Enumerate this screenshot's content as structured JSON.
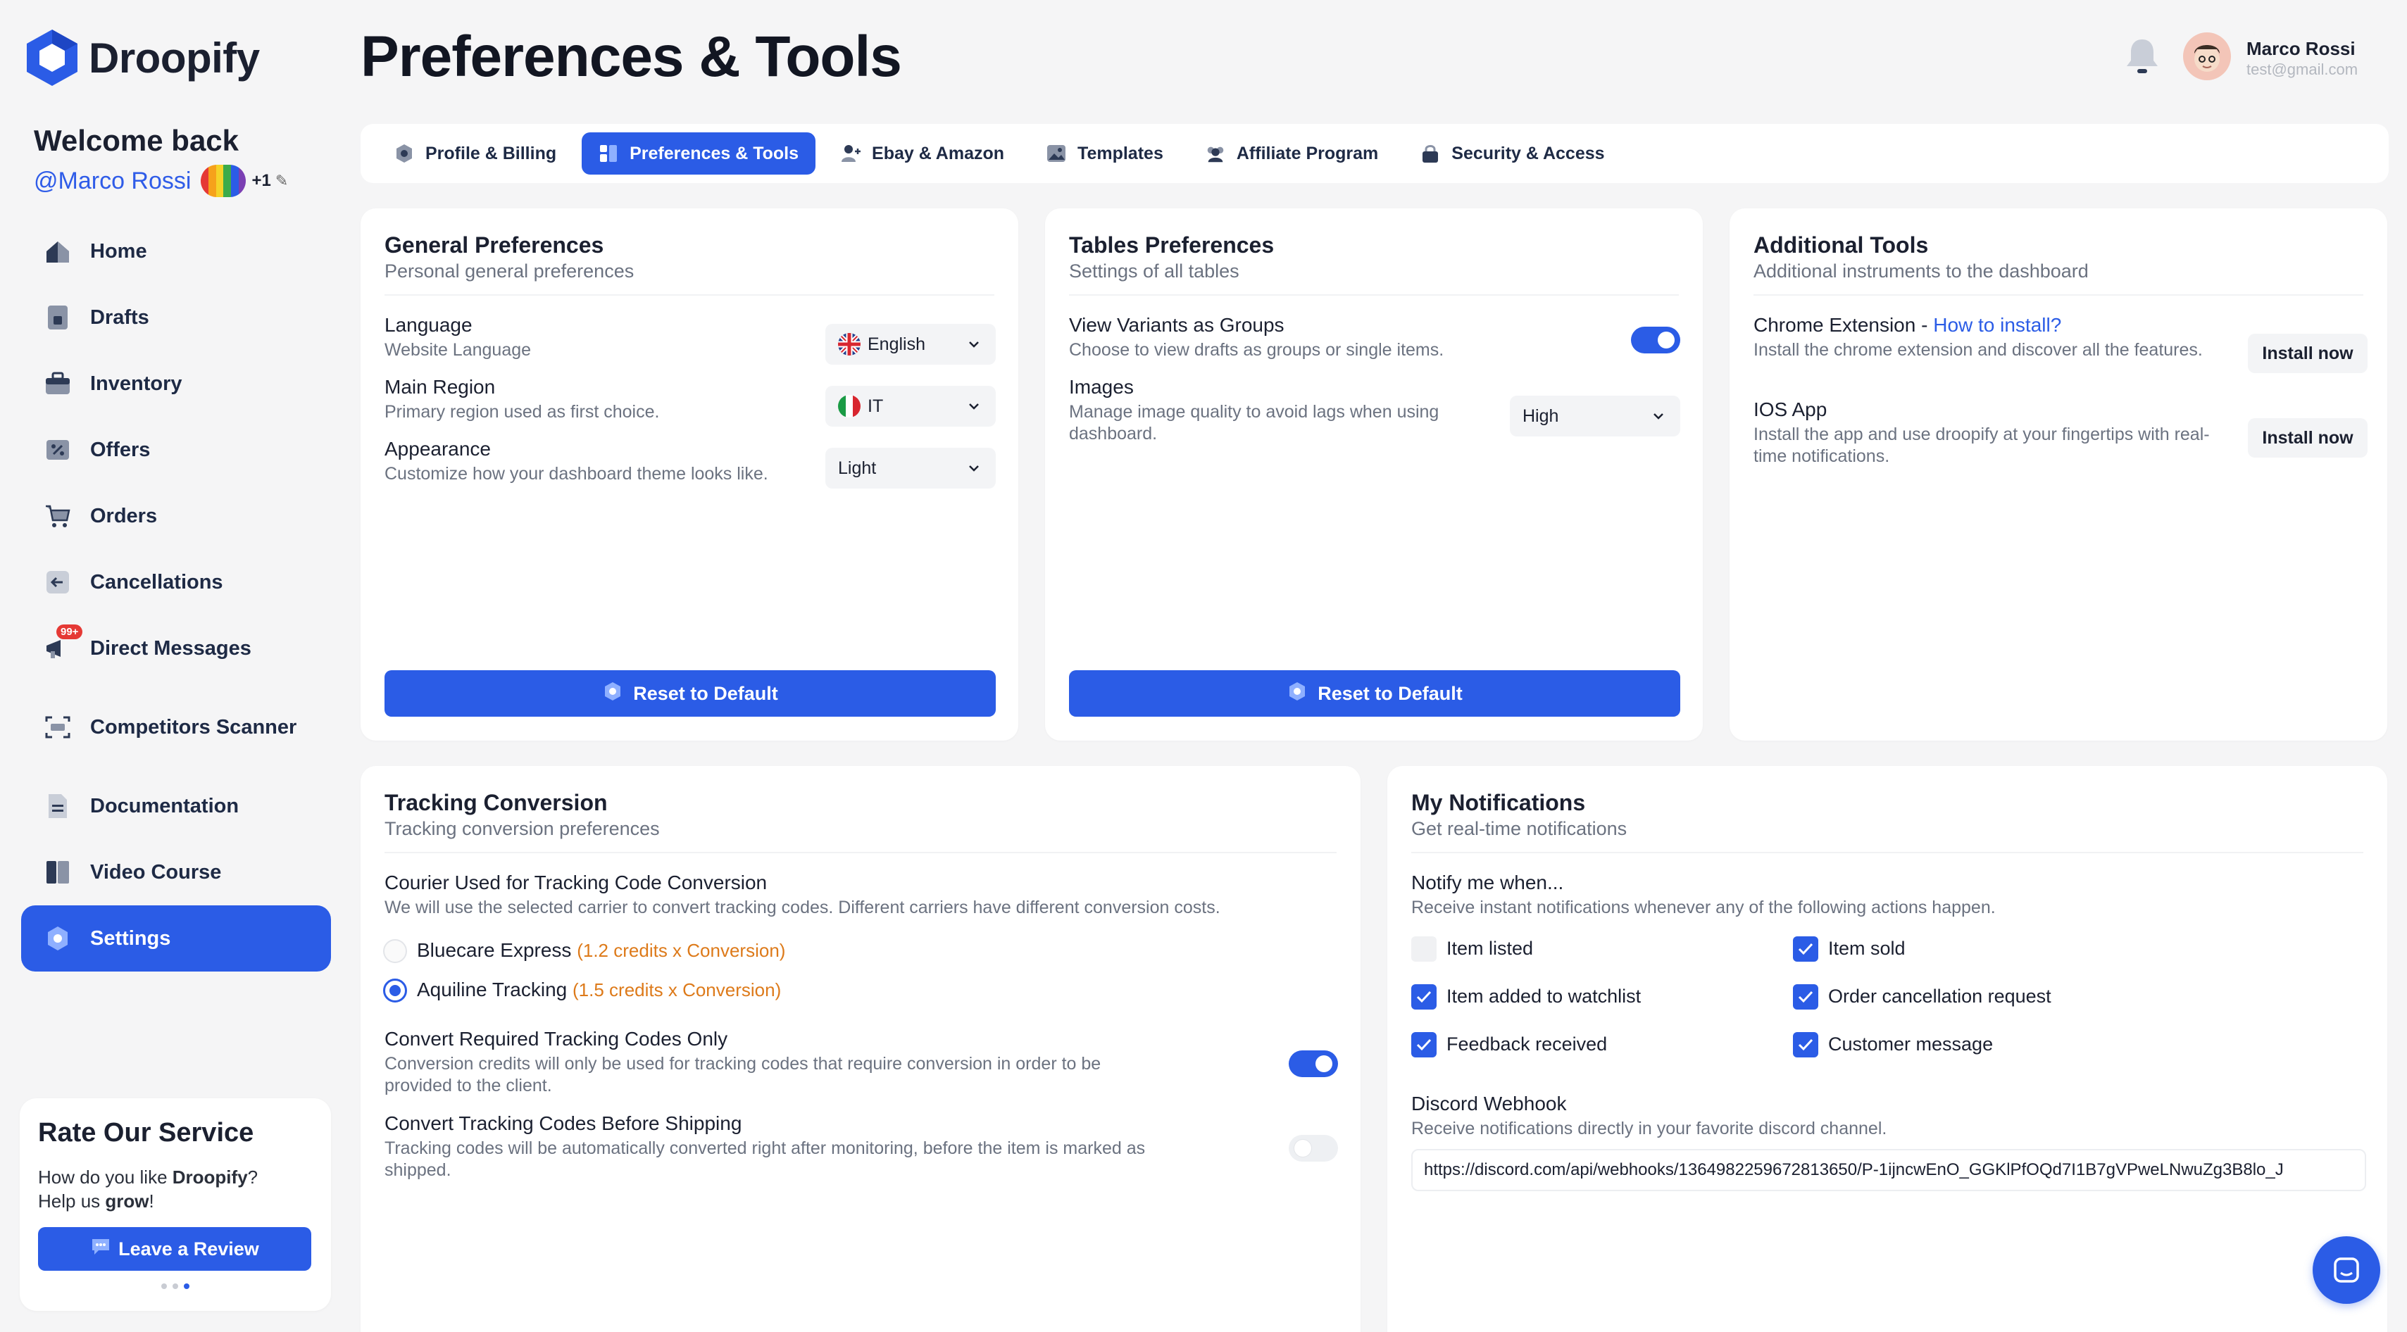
{
  "app": {
    "brand": "Droopify",
    "accent": "#2b5ce6"
  },
  "header": {
    "title": "Preferences & Tools",
    "user_name": "Marco Rossi",
    "user_email": "test@gmail.com"
  },
  "sidebar": {
    "welcome": "Welcome back",
    "handle": "@Marco Rossi",
    "extra_count": "+1",
    "items": [
      {
        "label": "Home",
        "icon": "home-icon"
      },
      {
        "label": "Drafts",
        "icon": "drafts-icon"
      },
      {
        "label": "Inventory",
        "icon": "briefcase-icon"
      },
      {
        "label": "Offers",
        "icon": "offers-icon"
      },
      {
        "label": "Orders",
        "icon": "cart-icon"
      },
      {
        "label": "Cancellations",
        "icon": "cancel-arrow-icon"
      },
      {
        "label": "Direct Messages",
        "icon": "megaphone-icon",
        "badge": "99+"
      },
      {
        "label": "Competitors Scanner",
        "icon": "scanner-icon"
      },
      {
        "label": "Documentation",
        "icon": "document-icon"
      },
      {
        "label": "Video Course",
        "icon": "book-icon"
      },
      {
        "label": "Settings",
        "icon": "gear-icon",
        "active": true
      }
    ],
    "rate": {
      "title": "Rate Our Service",
      "text_a": "How do you like ",
      "text_brand": "Droopify",
      "text_b": "? Help us ",
      "text_grow": "grow",
      "text_c": "!",
      "button": "Leave a Review"
    }
  },
  "tabs": [
    {
      "label": "Profile & Billing",
      "icon": "gear-icon"
    },
    {
      "label": "Preferences & Tools",
      "icon": "preferences-icon",
      "active": true
    },
    {
      "label": "Ebay & Amazon",
      "icon": "user-add-icon"
    },
    {
      "label": "Templates",
      "icon": "image-icon"
    },
    {
      "label": "Affiliate Program",
      "icon": "users-icon"
    },
    {
      "label": "Security & Access",
      "icon": "lock-icon"
    }
  ],
  "general": {
    "title": "General Preferences",
    "subtitle": "Personal general preferences",
    "language_label": "Language",
    "language_desc": "Website Language",
    "language_value": "English",
    "region_label": "Main Region",
    "region_desc": "Primary region used as first choice.",
    "region_value": "IT",
    "appearance_label": "Appearance",
    "appearance_desc": "Customize how your dashboard theme looks like.",
    "appearance_value": "Light",
    "reset": "Reset to Default"
  },
  "tables": {
    "title": "Tables Preferences",
    "subtitle": "Settings of all tables",
    "variants_label": "View Variants as Groups",
    "variants_desc": "Choose to view drafts as groups or single items.",
    "variants_on": true,
    "images_label": "Images",
    "images_desc": "Manage image quality to avoid lags when using dashboard.",
    "images_value": "High",
    "reset": "Reset to Default"
  },
  "tools": {
    "title": "Additional Tools",
    "subtitle": "Additional instruments to the dashboard",
    "chrome_label": "Chrome Extension - ",
    "chrome_link": "How to install?",
    "chrome_desc": "Install the chrome extension and discover all the features.",
    "chrome_button": "Install now",
    "ios_label": "IOS App",
    "ios_desc": "Install the app and use droopify at your fingertips with real-time notifications.",
    "ios_button": "Install now"
  },
  "tracking": {
    "title": "Tracking Conversion",
    "subtitle": "Tracking conversion preferences",
    "courier_label": "Courier Used for Tracking Code Conversion",
    "courier_desc": "We will use the selected carrier to convert tracking codes. Different carriers have different conversion costs.",
    "options": [
      {
        "name": "Bluecare Express",
        "cost": "(1.2 credits x Conversion)",
        "selected": false
      },
      {
        "name": "Aquiline Tracking",
        "cost": "(1.5 credits x Conversion)",
        "selected": true
      }
    ],
    "required_label": "Convert Required Tracking Codes Only",
    "required_desc": "Conversion credits will only be used for tracking codes that require conversion in order to be provided to the client.",
    "required_on": true,
    "before_label": "Convert Tracking Codes Before Shipping",
    "before_desc": "Tracking codes will be automatically converted right after monitoring, before the item is marked as shipped.",
    "before_on": false
  },
  "notifications": {
    "title": "My Notifications",
    "subtitle": "Get real-time notifications",
    "notify_label": "Notify me when...",
    "notify_desc": "Receive instant notifications whenever any of the following actions happen.",
    "items": [
      {
        "label": "Item listed",
        "checked": false
      },
      {
        "label": "Item sold",
        "checked": true
      },
      {
        "label": "Item added to watchlist",
        "checked": true
      },
      {
        "label": "Order cancellation request",
        "checked": true
      },
      {
        "label": "Feedback received",
        "checked": true
      },
      {
        "label": "Customer message",
        "checked": true
      }
    ],
    "webhook_label": "Discord Webhook",
    "webhook_desc": "Receive notifications directly in your favorite discord channel.",
    "webhook_value": "https://discord.com/api/webhooks/1364982259672813650/P-1ijncwEnO_GGKlPfOQd7I1B7gVPweLNwuZg3B8lo_J"
  }
}
